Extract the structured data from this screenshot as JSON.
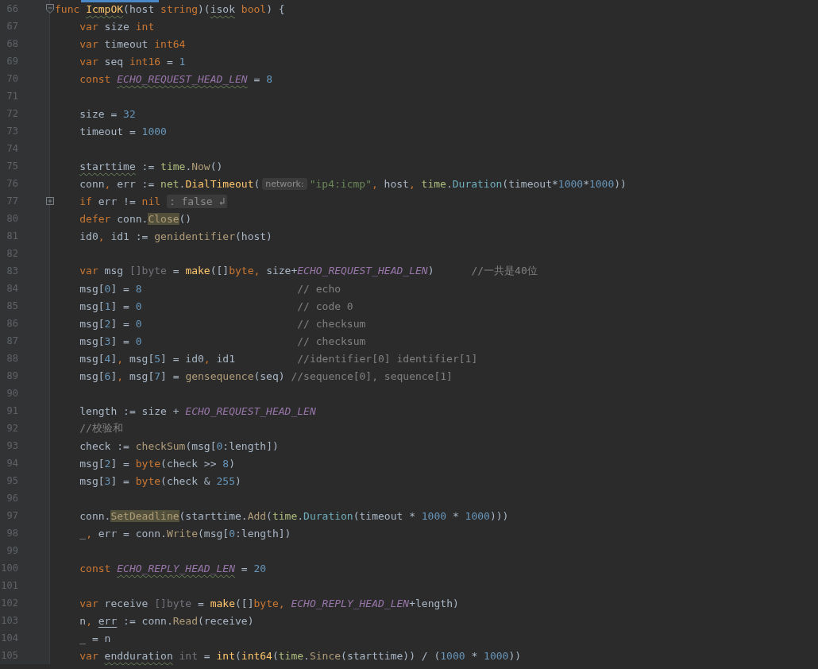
{
  "editor": {
    "lines": [
      {
        "number": "66",
        "indented": false,
        "fold": {
          "expanded": true
        },
        "tokens": [
          {
            "text": "func ",
            "kind": "kw"
          },
          {
            "text": "IcmpOK",
            "kind": "fn",
            "warning": true
          },
          {
            "text": "(host ",
            "kind": "plain"
          },
          {
            "text": "string",
            "kind": "kw"
          },
          {
            "text": ")(",
            "kind": "plain"
          },
          {
            "text": "isok",
            "kind": "plain",
            "warning": true
          },
          {
            "text": " bool",
            "kind": "kw"
          },
          {
            "text": ") {",
            "kind": "plain"
          }
        ]
      },
      {
        "number": "67",
        "indented": true,
        "tokens": [
          {
            "text": "var",
            "kind": "kw"
          },
          {
            "text": " size ",
            "kind": "plain"
          },
          {
            "text": "int",
            "kind": "kw"
          }
        ]
      },
      {
        "number": "68",
        "indented": true,
        "tokens": [
          {
            "text": "var",
            "kind": "kw"
          },
          {
            "text": " timeout ",
            "kind": "plain"
          },
          {
            "text": "int64",
            "kind": "kw"
          }
        ]
      },
      {
        "number": "69",
        "indented": true,
        "tokens": [
          {
            "text": "var",
            "kind": "kw"
          },
          {
            "text": " seq ",
            "kind": "plain"
          },
          {
            "text": "int16",
            "kind": "kw"
          },
          {
            "text": " = ",
            "kind": "plain"
          },
          {
            "text": "1",
            "kind": "num"
          }
        ]
      },
      {
        "number": "70",
        "indented": true,
        "tokens": [
          {
            "text": "const ",
            "kind": "kw"
          },
          {
            "text": "ECHO_REQUEST_HEAD_LEN",
            "kind": "const",
            "warning": true
          },
          {
            "text": " = ",
            "kind": "plain"
          },
          {
            "text": "8",
            "kind": "num"
          }
        ]
      },
      {
        "number": "71"
      },
      {
        "number": "72",
        "indented": true,
        "tokens": [
          {
            "text": "size = ",
            "kind": "plain"
          },
          {
            "text": "32",
            "kind": "num"
          }
        ]
      },
      {
        "number": "73",
        "indented": true,
        "tokens": [
          {
            "text": "timeout = ",
            "kind": "plain"
          },
          {
            "text": "1000",
            "kind": "num"
          }
        ]
      },
      {
        "number": "74"
      },
      {
        "number": "75",
        "indented": true,
        "tokens": [
          {
            "text": "starttime",
            "kind": "plain",
            "warning": true
          },
          {
            "text": " := ",
            "kind": "plain"
          },
          {
            "text": "time",
            "kind": "pkg"
          },
          {
            "text": ".",
            "kind": "plain"
          },
          {
            "text": "Now",
            "kind": "call"
          },
          {
            "text": "()",
            "kind": "plain"
          }
        ]
      },
      {
        "number": "76",
        "indented": true,
        "tokens": [
          {
            "text": "conn",
            "kind": "plain"
          },
          {
            "text": ",",
            "kind": "punct"
          },
          {
            "text": " err := ",
            "kind": "plain"
          },
          {
            "text": "net",
            "kind": "pkg"
          },
          {
            "text": ".",
            "kind": "plain"
          },
          {
            "text": "DialTimeout",
            "kind": "fn"
          },
          {
            "text": "(",
            "kind": "plain"
          },
          {
            "text": "network:",
            "kind": "hint"
          },
          {
            "text": "\"ip4:icmp\"",
            "kind": "str"
          },
          {
            "text": ",",
            "kind": "punct"
          },
          {
            "text": " host",
            "kind": "plain"
          },
          {
            "text": ", ",
            "kind": "punct"
          },
          {
            "text": "time",
            "kind": "pkg"
          },
          {
            "text": ".",
            "kind": "plain"
          },
          {
            "text": "Duration",
            "kind": "type"
          },
          {
            "text": "(timeout*",
            "kind": "plain"
          },
          {
            "text": "1000",
            "kind": "num"
          },
          {
            "text": "*",
            "kind": "plain"
          },
          {
            "text": "1000",
            "kind": "num"
          },
          {
            "text": "))",
            "kind": "plain"
          }
        ]
      },
      {
        "number": "77",
        "indented": true,
        "fold": {
          "expanded": false
        },
        "tokens": [
          {
            "text": "if",
            "kind": "kw"
          },
          {
            "text": " err != ",
            "kind": "plain"
          },
          {
            "text": "nil",
            "kind": "kw"
          },
          {
            "text": ": false ↲",
            "kind": "folded"
          }
        ]
      },
      {
        "number": "80",
        "indented": true,
        "tokens": [
          {
            "text": "defer",
            "kind": "kw"
          },
          {
            "text": " conn.",
            "kind": "plain"
          },
          {
            "text": "Close",
            "kind": "call",
            "highlight": true
          },
          {
            "text": "()",
            "kind": "plain"
          }
        ]
      },
      {
        "number": "81",
        "indented": true,
        "tokens": [
          {
            "text": "id0",
            "kind": "plain"
          },
          {
            "text": ",",
            "kind": "punct"
          },
          {
            "text": " id1 := ",
            "kind": "plain"
          },
          {
            "text": "genidentifier",
            "kind": "call"
          },
          {
            "text": "(host)",
            "kind": "plain"
          }
        ]
      },
      {
        "number": "82"
      },
      {
        "number": "83",
        "indented": true,
        "tokens": [
          {
            "text": "var",
            "kind": "kw"
          },
          {
            "text": " msg ",
            "kind": "plain"
          },
          {
            "text": "[]byte",
            "kind": "faded"
          },
          {
            "text": " = ",
            "kind": "plain"
          },
          {
            "text": "make",
            "kind": "fn"
          },
          {
            "text": "([]",
            "kind": "plain"
          },
          {
            "text": "byte",
            "kind": "kw"
          },
          {
            "text": ",",
            "kind": "punct"
          },
          {
            "text": " size+",
            "kind": "plain"
          },
          {
            "text": "ECHO_REQUEST_HEAD_LEN",
            "kind": "const"
          },
          {
            "text": ")",
            "kind": "plain"
          },
          {
            "text": "      //一共是40位",
            "kind": "comment"
          }
        ]
      },
      {
        "number": "84",
        "indented": true,
        "tokens": [
          {
            "text": "msg[",
            "kind": "plain"
          },
          {
            "text": "0",
            "kind": "num"
          },
          {
            "text": "] = ",
            "kind": "plain"
          },
          {
            "text": "8",
            "kind": "num"
          },
          {
            "text": "                         // echo",
            "kind": "comment"
          }
        ]
      },
      {
        "number": "85",
        "indented": true,
        "tokens": [
          {
            "text": "msg[",
            "kind": "plain"
          },
          {
            "text": "1",
            "kind": "num"
          },
          {
            "text": "] = ",
            "kind": "plain"
          },
          {
            "text": "0",
            "kind": "num"
          },
          {
            "text": "                         // code 0",
            "kind": "comment"
          }
        ]
      },
      {
        "number": "86",
        "indented": true,
        "tokens": [
          {
            "text": "msg[",
            "kind": "plain"
          },
          {
            "text": "2",
            "kind": "num"
          },
          {
            "text": "] = ",
            "kind": "plain"
          },
          {
            "text": "0",
            "kind": "num"
          },
          {
            "text": "                         // checksum",
            "kind": "comment"
          }
        ]
      },
      {
        "number": "87",
        "indented": true,
        "tokens": [
          {
            "text": "msg[",
            "kind": "plain"
          },
          {
            "text": "3",
            "kind": "num"
          },
          {
            "text": "] = ",
            "kind": "plain"
          },
          {
            "text": "0",
            "kind": "num"
          },
          {
            "text": "                         // checksum",
            "kind": "comment"
          }
        ]
      },
      {
        "number": "88",
        "indented": true,
        "tokens": [
          {
            "text": "msg[",
            "kind": "plain"
          },
          {
            "text": "4",
            "kind": "num"
          },
          {
            "text": "]",
            "kind": "plain"
          },
          {
            "text": ",",
            "kind": "punct"
          },
          {
            "text": " msg[",
            "kind": "plain"
          },
          {
            "text": "5",
            "kind": "num"
          },
          {
            "text": "] = id0",
            "kind": "plain"
          },
          {
            "text": ",",
            "kind": "punct"
          },
          {
            "text": " id1",
            "kind": "plain"
          },
          {
            "text": "          //identifier[0] identifier[1]",
            "kind": "comment"
          }
        ]
      },
      {
        "number": "89",
        "indented": true,
        "tokens": [
          {
            "text": "msg[",
            "kind": "plain"
          },
          {
            "text": "6",
            "kind": "num"
          },
          {
            "text": "]",
            "kind": "plain"
          },
          {
            "text": ",",
            "kind": "punct"
          },
          {
            "text": " msg[",
            "kind": "plain"
          },
          {
            "text": "7",
            "kind": "num"
          },
          {
            "text": "] = ",
            "kind": "plain"
          },
          {
            "text": "gensequence",
            "kind": "call"
          },
          {
            "text": "(seq)",
            "kind": "plain"
          },
          {
            "text": " //sequence[0], sequence[1]",
            "kind": "comment"
          }
        ]
      },
      {
        "number": "90"
      },
      {
        "number": "91",
        "indented": true,
        "tokens": [
          {
            "text": "length := size + ",
            "kind": "plain"
          },
          {
            "text": "ECHO_REQUEST_HEAD_LEN",
            "kind": "const"
          }
        ]
      },
      {
        "number": "92",
        "indented": true,
        "tokens": [
          {
            "text": "//校验和",
            "kind": "comment"
          }
        ]
      },
      {
        "number": "93",
        "indented": true,
        "tokens": [
          {
            "text": "check := ",
            "kind": "plain"
          },
          {
            "text": "checkSum",
            "kind": "call"
          },
          {
            "text": "(msg[",
            "kind": "plain"
          },
          {
            "text": "0",
            "kind": "num"
          },
          {
            "text": ":length])",
            "kind": "plain"
          }
        ]
      },
      {
        "number": "94",
        "indented": true,
        "tokens": [
          {
            "text": "msg[",
            "kind": "plain"
          },
          {
            "text": "2",
            "kind": "num"
          },
          {
            "text": "] = ",
            "kind": "plain"
          },
          {
            "text": "byte",
            "kind": "kw"
          },
          {
            "text": "(check >> ",
            "kind": "plain"
          },
          {
            "text": "8",
            "kind": "num"
          },
          {
            "text": ")",
            "kind": "plain"
          }
        ]
      },
      {
        "number": "95",
        "indented": true,
        "tokens": [
          {
            "text": "msg[",
            "kind": "plain"
          },
          {
            "text": "3",
            "kind": "num"
          },
          {
            "text": "] = ",
            "kind": "plain"
          },
          {
            "text": "byte",
            "kind": "kw"
          },
          {
            "text": "(check & ",
            "kind": "plain"
          },
          {
            "text": "255",
            "kind": "num"
          },
          {
            "text": ")",
            "kind": "plain"
          }
        ]
      },
      {
        "number": "96"
      },
      {
        "number": "97",
        "indented": true,
        "tokens": [
          {
            "text": "conn.",
            "kind": "plain"
          },
          {
            "text": "SetDeadline",
            "kind": "call",
            "highlight": true
          },
          {
            "text": "(starttime.",
            "kind": "plain"
          },
          {
            "text": "Add",
            "kind": "call"
          },
          {
            "text": "(",
            "kind": "plain"
          },
          {
            "text": "time",
            "kind": "pkg"
          },
          {
            "text": ".",
            "kind": "plain"
          },
          {
            "text": "Duration",
            "kind": "type"
          },
          {
            "text": "(timeout * ",
            "kind": "plain"
          },
          {
            "text": "1000",
            "kind": "num"
          },
          {
            "text": " * ",
            "kind": "plain"
          },
          {
            "text": "1000",
            "kind": "num"
          },
          {
            "text": ")))",
            "kind": "plain"
          }
        ]
      },
      {
        "number": "98",
        "indented": true,
        "tokens": [
          {
            "text": "_",
            "kind": "plain"
          },
          {
            "text": ",",
            "kind": "punct"
          },
          {
            "text": " err = conn.",
            "kind": "plain"
          },
          {
            "text": "Write",
            "kind": "call"
          },
          {
            "text": "(msg[",
            "kind": "plain"
          },
          {
            "text": "0",
            "kind": "num"
          },
          {
            "text": ":length])",
            "kind": "plain"
          }
        ]
      },
      {
        "number": "99"
      },
      {
        "number": "100",
        "indented": true,
        "tokens": [
          {
            "text": "const ",
            "kind": "kw"
          },
          {
            "text": "ECHO_REPLY_HEAD_LEN",
            "kind": "const",
            "warning": true
          },
          {
            "text": " = ",
            "kind": "plain"
          },
          {
            "text": "20",
            "kind": "num"
          }
        ]
      },
      {
        "number": "101"
      },
      {
        "number": "102",
        "indented": true,
        "tokens": [
          {
            "text": "var",
            "kind": "kw"
          },
          {
            "text": " receive ",
            "kind": "plain"
          },
          {
            "text": "[]byte",
            "kind": "faded"
          },
          {
            "text": " = ",
            "kind": "plain"
          },
          {
            "text": "make",
            "kind": "fn"
          },
          {
            "text": "([]",
            "kind": "plain"
          },
          {
            "text": "byte",
            "kind": "kw"
          },
          {
            "text": ", ",
            "kind": "punct"
          },
          {
            "text": "ECHO_REPLY_HEAD_LEN",
            "kind": "const"
          },
          {
            "text": "+length)",
            "kind": "plain"
          }
        ]
      },
      {
        "number": "103",
        "indented": true,
        "tokens": [
          {
            "text": "n",
            "kind": "plain"
          },
          {
            "text": ", ",
            "kind": "punct"
          },
          {
            "text": "err",
            "kind": "plain",
            "underlined": true
          },
          {
            "text": " := conn.",
            "kind": "plain"
          },
          {
            "text": "Read",
            "kind": "call"
          },
          {
            "text": "(receive)",
            "kind": "plain"
          }
        ]
      },
      {
        "number": "104",
        "indented": true,
        "tokens": [
          {
            "text": "_ = n",
            "kind": "plain"
          }
        ]
      },
      {
        "number": "105",
        "indented": true,
        "tokens": [
          {
            "text": "var ",
            "kind": "kw"
          },
          {
            "text": "endduration",
            "kind": "plain",
            "warning": true
          },
          {
            "text": " int",
            "kind": "faded"
          },
          {
            "text": " = ",
            "kind": "plain"
          },
          {
            "text": "int",
            "kind": "fn"
          },
          {
            "text": "(",
            "kind": "plain"
          },
          {
            "text": "int64",
            "kind": "fn"
          },
          {
            "text": "(",
            "kind": "plain"
          },
          {
            "text": "time",
            "kind": "pkg"
          },
          {
            "text": ".",
            "kind": "plain"
          },
          {
            "text": "Since",
            "kind": "call"
          },
          {
            "text": "(starttime)) / (",
            "kind": "plain"
          },
          {
            "text": "1000",
            "kind": "num"
          },
          {
            "text": " * ",
            "kind": "plain"
          },
          {
            "text": "1000",
            "kind": "num"
          },
          {
            "text": "))",
            "kind": "plain"
          }
        ]
      }
    ]
  }
}
